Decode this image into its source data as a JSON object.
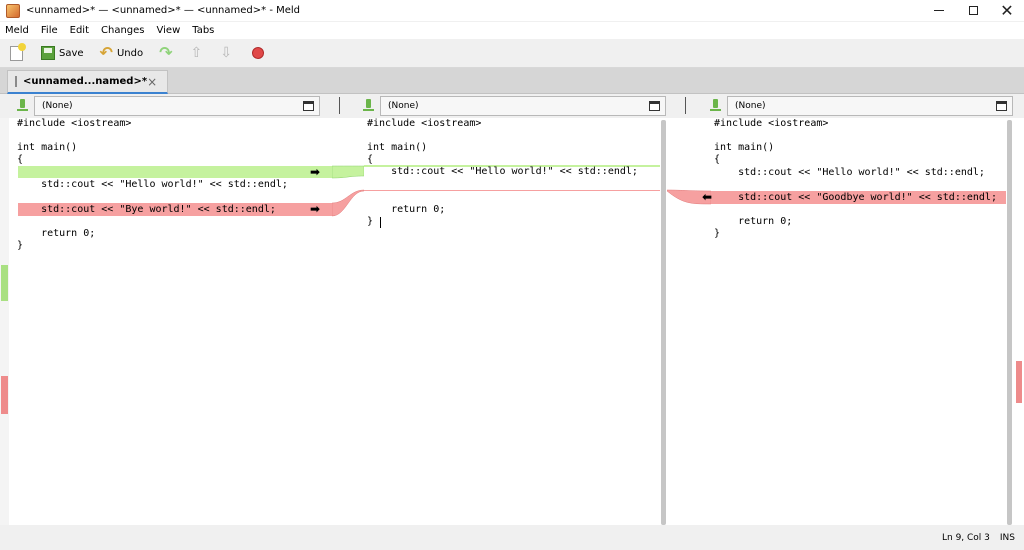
{
  "window": {
    "title": "<unnamed>* — <unnamed>* — <unnamed>* - Meld",
    "controls": {
      "minimize": "",
      "maximize": "",
      "close": "✕"
    }
  },
  "menubar": [
    "Meld",
    "File",
    "Edit",
    "Changes",
    "View",
    "Tabs"
  ],
  "toolbar": {
    "save_label": "Save",
    "undo_label": "Undo"
  },
  "tab": {
    "label": "<unnamed...named>*",
    "close": "×"
  },
  "files": [
    {
      "label": "(None)"
    },
    {
      "label": "(None)"
    },
    {
      "label": "(None)"
    }
  ],
  "panes": [
    {
      "lines": [
        "#include <iostream>",
        "",
        "int main()",
        "{",
        "",
        "    std::cout << \"Hello world!\" << std::endl;",
        "",
        "    std::cout << \"Bye world!\" << std::endl;",
        "",
        "    return 0;",
        "}"
      ]
    },
    {
      "lines": [
        "#include <iostream>",
        "",
        "int main()",
        "{",
        "    std::cout << \"Hello world!\" << std::endl;",
        "",
        "",
        "    return 0;",
        "}"
      ]
    },
    {
      "lines": [
        "#include <iostream>",
        "",
        "int main()",
        "{",
        "    std::cout << \"Hello world!\" << std::endl;",
        "",
        "    std::cout << \"Goodbye world!\" << std::endl;",
        "",
        "    return 0;",
        "}"
      ]
    }
  ],
  "arrows": {
    "right": "➡",
    "left": "⬅"
  },
  "colors": {
    "insert": "#c5f29e",
    "conflict": "#f6a0a0",
    "accent": "#3b82d0"
  },
  "status": {
    "position": "Ln 9, Col 3",
    "mode": "INS"
  }
}
